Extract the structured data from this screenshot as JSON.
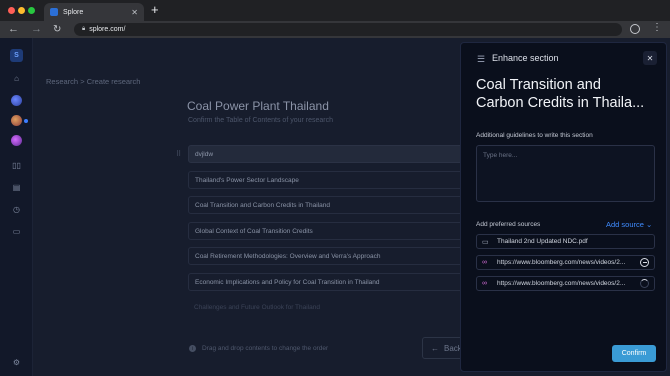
{
  "browser": {
    "tab_title": "Splore",
    "url": "splore.com/"
  },
  "breadcrumb": {
    "root": "Research",
    "separator": ">",
    "current": "Create research"
  },
  "research": {
    "title": "Coal Power Plant Thailand",
    "subtitle": "Confirm the Table of Contents of your research",
    "rows": [
      "dvjldw",
      "Thailand's Power Sector Landscape",
      "Coal Transition and Carbon Credits in Thailand",
      "Global Context of Coal Transition Credits",
      "Coal Retirement Methodologies: Overview and Verra's Approach",
      "Economic Implications and Policy for Coal Transition in Thailand",
      "Challenges and Future Outlook for Thailand"
    ],
    "hint": "Drag and drop contents to change the order",
    "back_label": "Back"
  },
  "panel": {
    "title": "Enhance section",
    "heading_line1": "Coal Transition and",
    "heading_line2": "Carbon Credits in Thaila...",
    "guidelines_label": "Additional guidelines to write this section",
    "guidelines_placeholder": "Type here...",
    "sources_label": "Add preferred sources",
    "add_source_label": "Add source",
    "sources": [
      {
        "type": "file",
        "label": "Thailand 2nd Updated NDC.pdf",
        "status": "none"
      },
      {
        "type": "link",
        "label": "https://www.bloomberg.com/news/videos/2...",
        "status": "remove"
      },
      {
        "type": "link",
        "label": "https://www.bloomberg.com/news/videos/2...",
        "status": "loading"
      }
    ],
    "confirm_label": "Confirm"
  },
  "colors": {
    "accent": "#3a9bd5",
    "link": "#3f8cff",
    "background": "#171d2d",
    "panel": "#0a0f1c"
  },
  "icons": [
    "back-icon",
    "forward-icon",
    "reload-icon",
    "lock-icon",
    "home-icon",
    "folder-icon",
    "document-icon",
    "history-icon",
    "chat-icon",
    "settings-icon",
    "sliders-icon",
    "close-icon",
    "link-icon",
    "info-icon",
    "chevron-down-icon"
  ]
}
